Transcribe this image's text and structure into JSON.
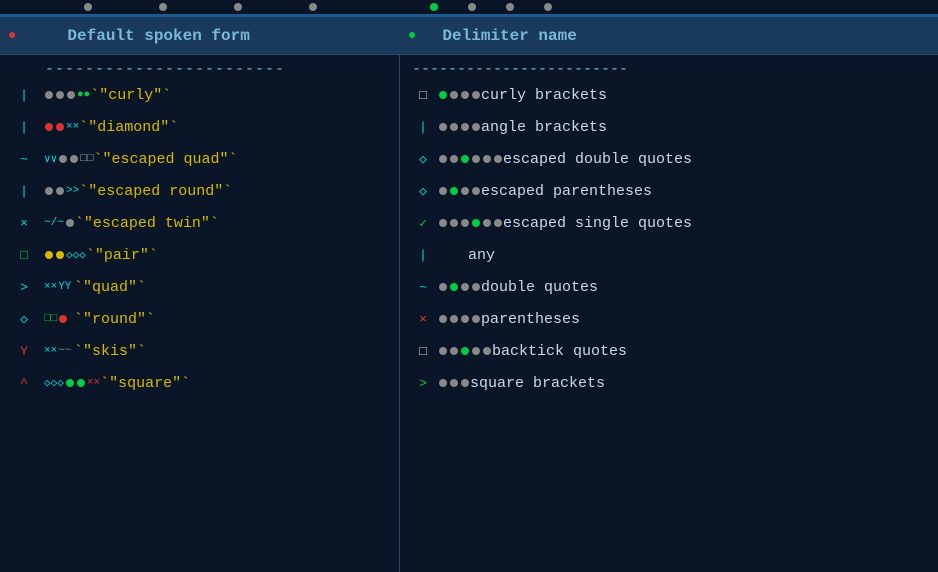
{
  "header": {
    "col1": "Default spoken form",
    "col2": "Delimiter name",
    "divider": "------------------------"
  },
  "left_items": [
    {
      "gutter_symbol": "|",
      "gutter_color": "cyan",
      "indicators": [
        {
          "type": "dot",
          "color": "gray"
        },
        {
          "type": "dot",
          "color": "gray"
        },
        {
          "type": "dot",
          "color": "gray"
        }
      ],
      "indicators2": [
        {
          "type": "dot",
          "color": "green"
        },
        {
          "type": "dot",
          "color": "green"
        }
      ],
      "text": "\"curly\"",
      "text_color": "yellow",
      "ticks": "``"
    },
    {
      "gutter_symbol": "|",
      "gutter_color": "cyan",
      "indicators": [
        {
          "type": "dot",
          "color": "red"
        },
        {
          "type": "dot",
          "color": "red"
        }
      ],
      "indicators2": [
        {
          "type": "x",
          "color": "cyan"
        },
        {
          "type": "x",
          "color": "cyan"
        }
      ],
      "text": "\"diamond\"",
      "text_color": "yellow",
      "ticks": "``"
    },
    {
      "gutter_symbol": "~",
      "gutter_color": "cyan",
      "indicators": [
        {
          "type": "v",
          "color": "cyan"
        },
        {
          "type": "v",
          "color": "cyan"
        }
      ],
      "indicators2": [
        {
          "type": "dot",
          "color": "gray"
        },
        {
          "type": "dot",
          "color": "gray"
        }
      ],
      "indicators3": [
        {
          "type": "sq",
          "color": "white"
        },
        {
          "type": "sq",
          "color": "white"
        }
      ],
      "text": "\"escaped quad\"",
      "text_color": "yellow",
      "ticks": "``"
    },
    {
      "gutter_symbol": "|",
      "gutter_color": "cyan",
      "indicators": [
        {
          "type": "dot",
          "color": "gray"
        }
      ],
      "indicators2": [
        {
          "type": ">",
          "color": "cyan"
        },
        {
          "type": ">",
          "color": "cyan"
        }
      ],
      "text": "\"escaped round\"",
      "text_color": "yellow",
      "ticks": "``"
    },
    {
      "gutter_symbol": "x",
      "gutter_color": "cyan",
      "indicators": [
        {
          "type": "~"
        },
        {
          "type": "~"
        }
      ],
      "indicators2": [
        {
          "type": "dot",
          "color": "gray"
        }
      ],
      "text": "\"escaped twin\"",
      "text_color": "yellow",
      "ticks": ""
    },
    {
      "gutter_symbol": "□",
      "gutter_color": "green",
      "indicators": [
        {
          "type": "dot",
          "color": "yellow"
        },
        {
          "type": "dot",
          "color": "yellow"
        }
      ],
      "indicators2": [
        {
          "type": "♢",
          "color": "cyan"
        },
        {
          "type": "♢",
          "color": "cyan"
        },
        {
          "type": "♢",
          "color": "cyan"
        }
      ],
      "text": "\"pair\"",
      "text_color": "yellow",
      "ticks": "``"
    },
    {
      "gutter_symbol": ">",
      "gutter_color": "cyan",
      "indicators": [
        {
          "type": "x",
          "color": "cyan"
        },
        {
          "type": "x",
          "color": "cyan"
        }
      ],
      "indicators2": [
        {
          "type": "Y",
          "color": "cyan"
        },
        {
          "type": "Y",
          "color": "cyan"
        }
      ],
      "text": "\"quad\"",
      "text_color": "yellow",
      "ticks": ""
    },
    {
      "gutter_symbol": "◇",
      "gutter_color": "cyan",
      "indicators": [
        {
          "type": "sq",
          "color": "green"
        },
        {
          "type": "sq",
          "color": "green"
        }
      ],
      "indicators2": [
        {
          "type": "dot",
          "color": "red"
        }
      ],
      "text": "\"round\"",
      "text_color": "yellow",
      "ticks": "``"
    },
    {
      "gutter_symbol": "Y",
      "gutter_color": "red",
      "indicators": [
        {
          "type": "x",
          "color": "cyan"
        },
        {
          "type": "x",
          "color": "cyan"
        }
      ],
      "indicators2": [
        {
          "type": "~"
        },
        {
          "type": "~"
        }
      ],
      "text": "\"skis\"",
      "text_color": "yellow",
      "ticks": "``"
    },
    {
      "gutter_symbol": "^",
      "gutter_color": "red",
      "indicators": [
        {
          "type": "◇",
          "color": "cyan"
        },
        {
          "type": "◇",
          "color": "cyan"
        },
        {
          "type": "◇",
          "color": "cyan"
        }
      ],
      "indicators2": [
        {
          "type": "dot",
          "color": "green"
        },
        {
          "type": "dot",
          "color": "green"
        }
      ],
      "indicators3": [
        {
          "type": "x",
          "color": "red"
        },
        {
          "type": "x",
          "color": "red"
        }
      ],
      "text": "\"square\"",
      "text_color": "yellow",
      "ticks": ""
    }
  ],
  "right_items": [
    {
      "gutter_symbol": "□",
      "gutter_color": "white",
      "indicators": [
        {
          "type": "dot",
          "color": "green"
        },
        {
          "type": "dot",
          "color": "gray"
        },
        {
          "type": "dot",
          "color": "gray"
        },
        {
          "type": "dot",
          "color": "gray"
        }
      ],
      "text": "curly brackets"
    },
    {
      "gutter_symbol": "|",
      "gutter_color": "cyan",
      "indicators": [
        {
          "type": "dot",
          "color": "gray"
        },
        {
          "type": "dot",
          "color": "gray"
        },
        {
          "type": "dot",
          "color": "gray"
        },
        {
          "type": "dot",
          "color": "gray"
        }
      ],
      "text": "angle brackets"
    },
    {
      "gutter_symbol": "◇",
      "gutter_color": "cyan",
      "indicators": [
        {
          "type": "dot",
          "color": "gray"
        },
        {
          "type": "dot",
          "color": "gray"
        },
        {
          "type": "dot",
          "color": "green"
        },
        {
          "type": "dot",
          "color": "gray"
        },
        {
          "type": "dot",
          "color": "gray"
        },
        {
          "type": "dot",
          "color": "gray"
        }
      ],
      "text": "escaped double quotes"
    },
    {
      "gutter_symbol": "◇",
      "gutter_color": "cyan",
      "indicators": [
        {
          "type": "dot",
          "color": "gray"
        },
        {
          "type": "dot",
          "color": "green"
        },
        {
          "type": "dot",
          "color": "gray"
        },
        {
          "type": "dot",
          "color": "gray"
        }
      ],
      "text": "escaped parentheses"
    },
    {
      "gutter_symbol": "✓",
      "gutter_color": "green",
      "indicators": [
        {
          "type": "dot",
          "color": "gray"
        },
        {
          "type": "dot",
          "color": "gray"
        },
        {
          "type": "dot",
          "color": "gray"
        },
        {
          "type": "dot",
          "color": "green"
        },
        {
          "type": "dot",
          "color": "gray"
        },
        {
          "type": "dot",
          "color": "gray"
        }
      ],
      "text": "escaped single quotes"
    },
    {
      "gutter_symbol": "|",
      "gutter_color": "cyan",
      "indicators": [],
      "text": "any"
    },
    {
      "gutter_symbol": "~",
      "gutter_color": "cyan",
      "indicators": [
        {
          "type": "dot",
          "color": "gray"
        },
        {
          "type": "dot",
          "color": "green"
        },
        {
          "type": "dot",
          "color": "gray"
        },
        {
          "type": "dot",
          "color": "gray"
        }
      ],
      "text": "double quotes"
    },
    {
      "gutter_symbol": "x",
      "gutter_color": "red",
      "indicators": [
        {
          "type": "dot",
          "color": "gray"
        },
        {
          "type": "dot",
          "color": "gray"
        },
        {
          "type": "dot",
          "color": "gray"
        },
        {
          "type": "dot",
          "color": "gray"
        }
      ],
      "text": "parentheses"
    },
    {
      "gutter_symbol": "□",
      "gutter_color": "white",
      "indicators": [
        {
          "type": "dot",
          "color": "gray"
        },
        {
          "type": "dot",
          "color": "gray"
        },
        {
          "type": "dot",
          "color": "gray"
        },
        {
          "type": "dot",
          "color": "green"
        },
        {
          "type": "dot",
          "color": "gray"
        }
      ],
      "text": "backtick quotes"
    },
    {
      "gutter_symbol": ">",
      "gutter_color": "green",
      "indicators": [
        {
          "type": "dot",
          "color": "gray"
        },
        {
          "type": "dot",
          "color": "gray"
        },
        {
          "type": "dot",
          "color": "gray"
        }
      ],
      "text": "square brackets"
    }
  ]
}
